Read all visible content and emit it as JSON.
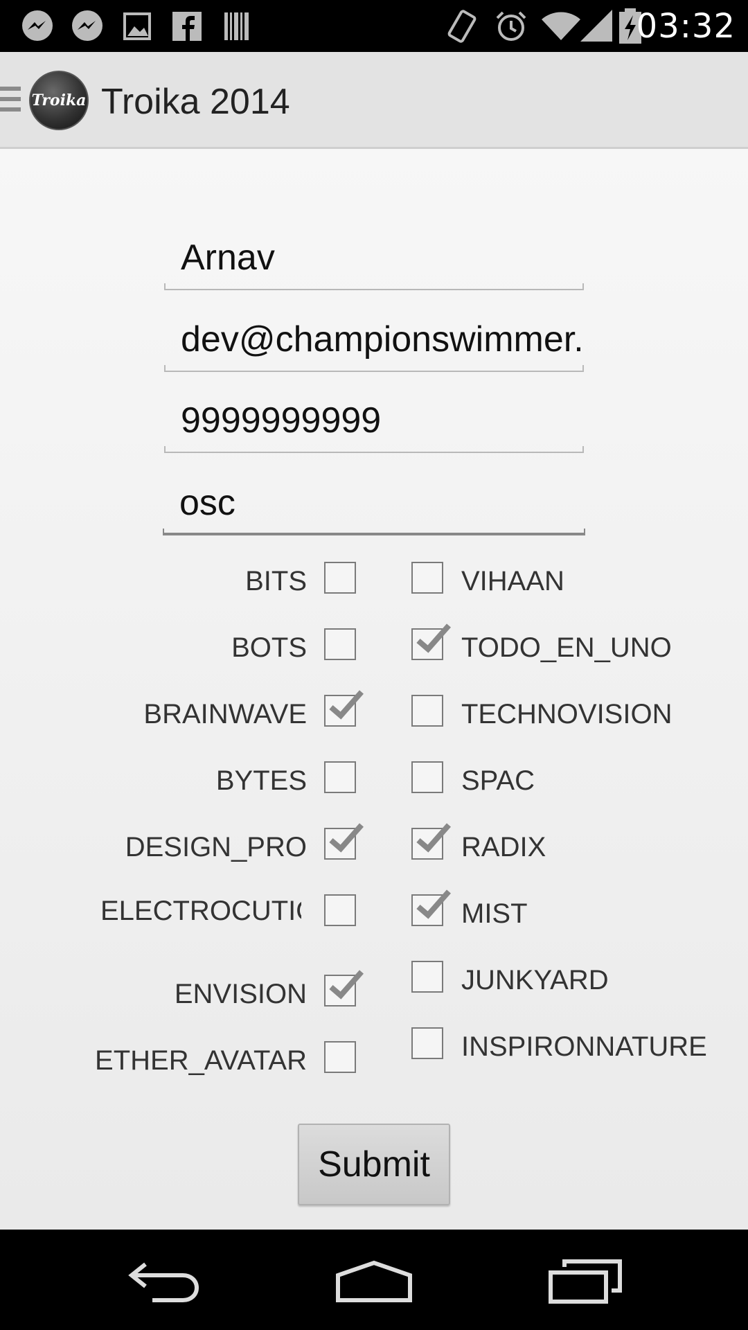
{
  "status_bar": {
    "time": "03:32",
    "left_icons": [
      "messenger-icon",
      "messenger-icon",
      "image-icon",
      "facebook-icon",
      "barcode-icon"
    ],
    "right_icons": [
      "vibrate-icon",
      "alarm-icon",
      "wifi-icon",
      "signal-icon",
      "battery-charging-icon"
    ]
  },
  "action_bar": {
    "title": "Troika 2014",
    "logo_text": "Troika"
  },
  "form": {
    "name": "Arnav",
    "email": "dev@championswimmer.in",
    "phone": "9999999999",
    "college": "osc"
  },
  "events_left": [
    {
      "label": "BITS",
      "checked": false
    },
    {
      "label": "BOTS",
      "checked": false
    },
    {
      "label": "BRAINWAVE",
      "checked": true
    },
    {
      "label": "BYTES",
      "checked": false
    },
    {
      "label": "DESIGN_PRO",
      "checked": true
    },
    {
      "label": "ELECTROCUTION",
      "checked": false
    },
    {
      "label": "ENVISION",
      "checked": true
    },
    {
      "label": "ETHER_AVATAR",
      "checked": false
    }
  ],
  "events_right": [
    {
      "label": "VIHAAN",
      "checked": false
    },
    {
      "label": "TODO_EN_UNO",
      "checked": true
    },
    {
      "label": "TECHNOVISION",
      "checked": false
    },
    {
      "label": "SPAC",
      "checked": false
    },
    {
      "label": "RADIX",
      "checked": true
    },
    {
      "label": "MIST",
      "checked": true
    },
    {
      "label": "JUNKYARD",
      "checked": false
    },
    {
      "label": "INSPIRONNATURE",
      "checked": false
    }
  ],
  "submit_label": "Submit",
  "nav_bar": {
    "icons": [
      "back-icon",
      "home-icon",
      "recent-apps-icon"
    ]
  },
  "colors": {
    "status_bar": "#000000",
    "action_bar": "#e3e3e3",
    "content_bg": "#f2f2f2",
    "nav_bar": "#000000"
  }
}
